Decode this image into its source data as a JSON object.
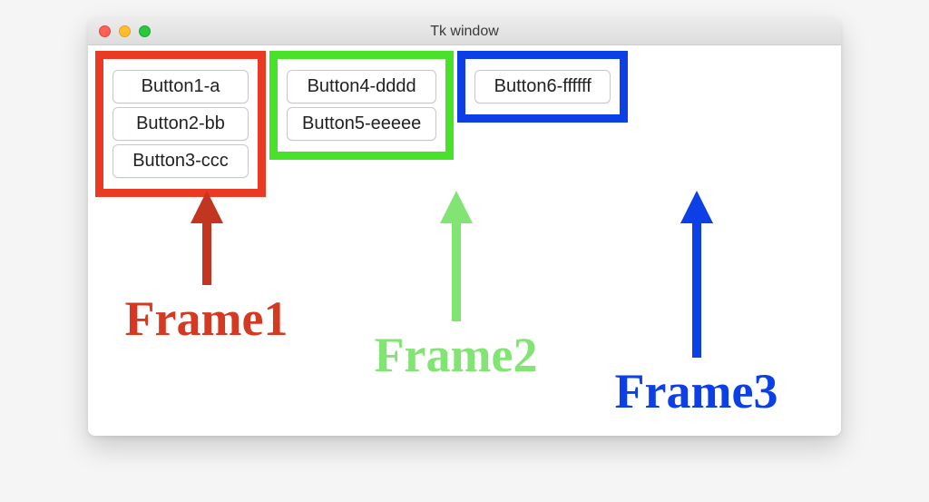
{
  "window": {
    "title": "Tk window"
  },
  "frames": {
    "frame1": {
      "color": "#ea3a24",
      "label": "Frame1",
      "buttons": [
        "Button1-a",
        "Button2-bb",
        "Button3-ccc"
      ]
    },
    "frame2": {
      "color": "#48e22b",
      "label": "Frame2",
      "buttons": [
        "Button4-dddd",
        "Button5-eeeee"
      ]
    },
    "frame3": {
      "color": "#0c3fe6",
      "label": "Frame3",
      "buttons": [
        "Button6-ffffff"
      ]
    }
  }
}
